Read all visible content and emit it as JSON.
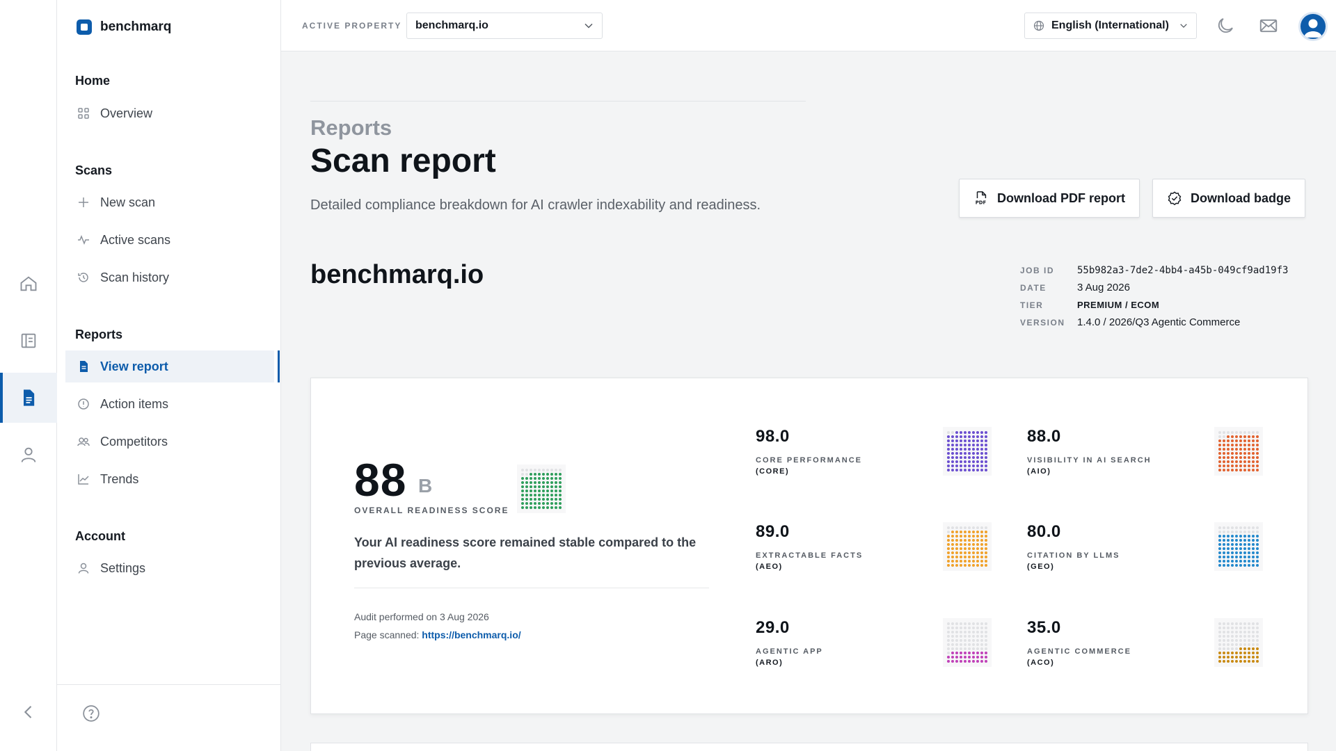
{
  "brand": {
    "name": "benchmarq"
  },
  "nav": {
    "sections": [
      {
        "heading": "Home",
        "items": [
          {
            "label": "Overview",
            "icon": "grid-icon"
          }
        ]
      },
      {
        "heading": "Scans",
        "items": [
          {
            "label": "New scan",
            "icon": "plus-icon"
          },
          {
            "label": "Active scans",
            "icon": "activity-icon"
          },
          {
            "label": "Scan history",
            "icon": "history-icon"
          }
        ]
      },
      {
        "heading": "Reports",
        "items": [
          {
            "label": "View report",
            "icon": "document-icon",
            "active": true
          },
          {
            "label": "Action items",
            "icon": "alert-circle-icon"
          },
          {
            "label": "Competitors",
            "icon": "users-icon"
          },
          {
            "label": "Trends",
            "icon": "chart-line-icon"
          }
        ]
      },
      {
        "heading": "Account",
        "items": [
          {
            "label": "Settings",
            "icon": "user-icon"
          }
        ]
      }
    ]
  },
  "topbar": {
    "property_label": "ACTIVE PROPERTY",
    "property_value": "benchmarq.io",
    "language": "English (International)"
  },
  "page": {
    "breadcrumb": "Reports",
    "title": "Scan report",
    "description": "Detailed compliance breakdown for AI crawler indexability and readiness.",
    "buttons": {
      "pdf": "Download PDF report",
      "badge": "Download badge"
    },
    "site": "benchmarq.io",
    "meta": [
      {
        "key": "JOB ID",
        "value": "55b982a3-7de2-4bb4-a45b-049cf9ad19f3"
      },
      {
        "key": "DATE",
        "value": "3 Aug 2026"
      },
      {
        "key": "TIER",
        "value": "PREMIUM / ECOM"
      },
      {
        "key": "VERSION",
        "value": "1.4.0 / 2026/Q3 Agentic Commerce"
      }
    ]
  },
  "score": {
    "value": "88",
    "grade": "B",
    "label": "OVERALL READINESS SCORE",
    "fill": 0.88,
    "color": "#2e9e5b",
    "message": "Your AI readiness score remained stable compared to the previous average.",
    "audit_prefix": "Audit performed on",
    "audit_date": "3 Aug 2026",
    "page_prefix": "Page scanned:",
    "page_url": "https://benchmarq.io/"
  },
  "metrics": [
    {
      "value": "98.0",
      "name": "CORE PERFORMANCE",
      "abbr": "(CORE)",
      "color": "#6b4fd0",
      "fill": 0.98
    },
    {
      "value": "88.0",
      "name": "VISIBILITY IN AI SEARCH",
      "abbr": "(AIO)",
      "color": "#e2622f",
      "fill": 0.88
    },
    {
      "value": "89.0",
      "name": "EXTRACTABLE FACTS",
      "abbr": "(AEO)",
      "color": "#f0a12a",
      "fill": 0.89
    },
    {
      "value": "80.0",
      "name": "CITATION BY LLMS",
      "abbr": "(GEO)",
      "color": "#2288cc",
      "fill": 0.8
    },
    {
      "value": "29.0",
      "name": "AGENTIC APP",
      "abbr": "(ARO)",
      "color": "#c040b8",
      "fill": 0.29
    },
    {
      "value": "35.0",
      "name": "AGENTIC COMMERCE",
      "abbr": "(ACO)",
      "color": "#c98a12",
      "fill": 0.35
    }
  ]
}
